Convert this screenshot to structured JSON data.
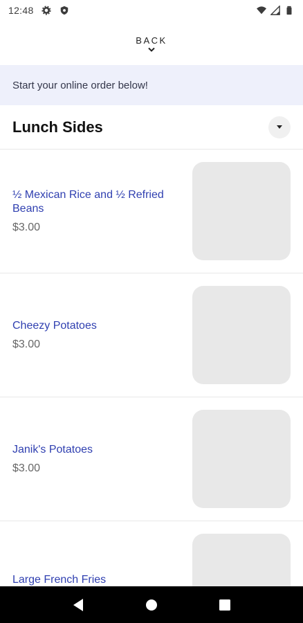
{
  "status_bar": {
    "time": "12:48",
    "left_icons": [
      "gear-icon",
      "shield-icon"
    ],
    "right_icons": [
      "wifi-icon",
      "signal-icon",
      "battery-icon"
    ]
  },
  "header": {
    "back_label": "BACK"
  },
  "banner": {
    "text": "Start your online order below!"
  },
  "section": {
    "title": "Lunch Sides"
  },
  "items": [
    {
      "name": "½ Mexican Rice and ½ Refried Beans",
      "price": "$3.00"
    },
    {
      "name": "Cheezy Potatoes",
      "price": "$3.00"
    },
    {
      "name": "Janik's Potatoes",
      "price": "$3.00"
    },
    {
      "name": "Large French Fries",
      "price": ""
    }
  ],
  "colors": {
    "accent": "#2f3fb0",
    "banner_bg": "#eef0fb",
    "placeholder": "#e8e8e8"
  }
}
